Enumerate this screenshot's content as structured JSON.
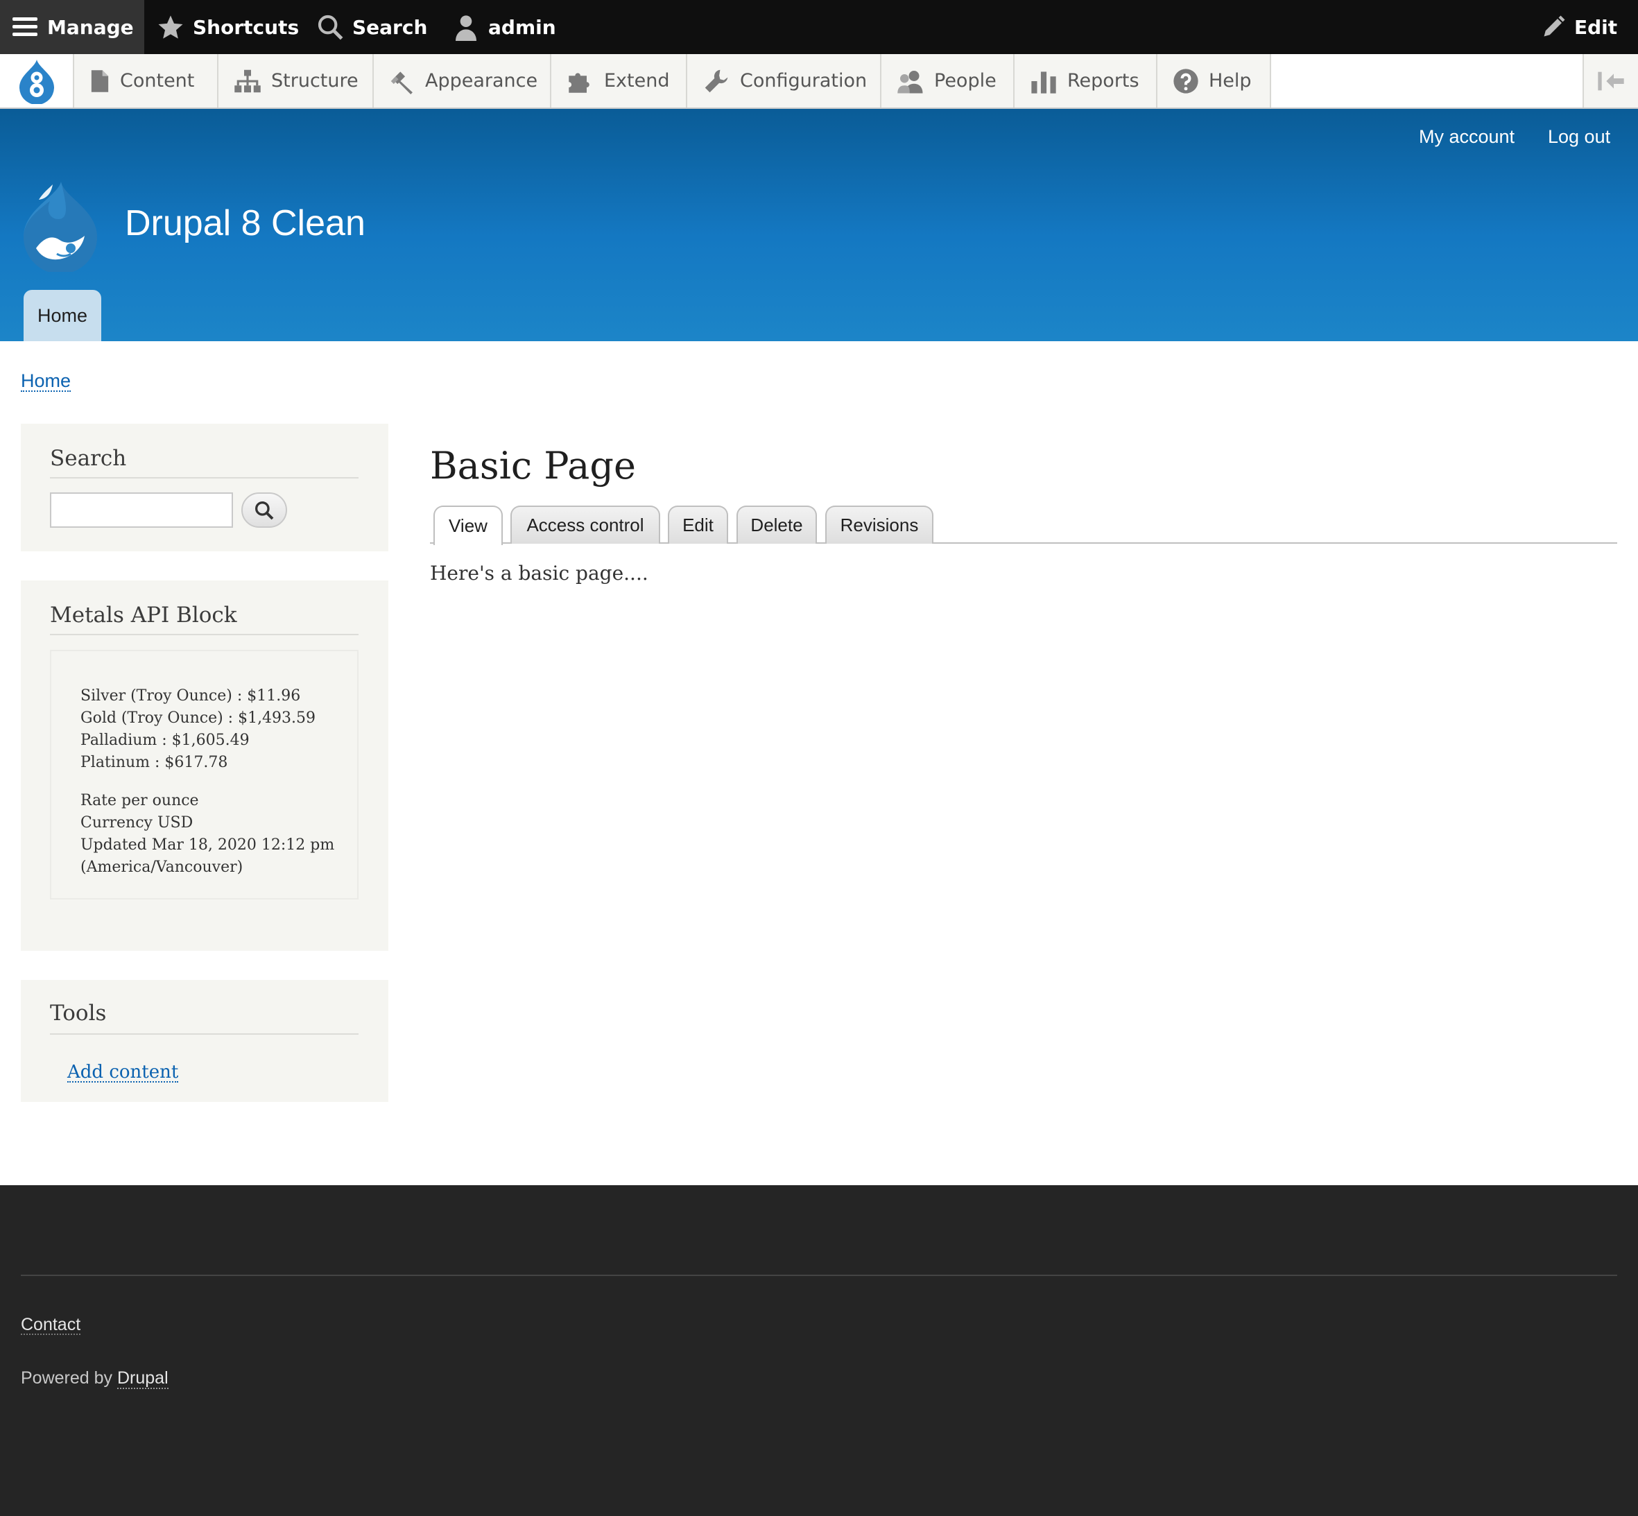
{
  "toolbar": {
    "manage": "Manage",
    "shortcuts": "Shortcuts",
    "search": "Search",
    "user": "admin",
    "edit": "Edit"
  },
  "tray": {
    "items": [
      {
        "label": "Content",
        "icon": "file-icon"
      },
      {
        "label": "Structure",
        "icon": "sitemap-icon"
      },
      {
        "label": "Appearance",
        "icon": "paintbrush-icon"
      },
      {
        "label": "Extend",
        "icon": "puzzle-icon"
      },
      {
        "label": "Configuration",
        "icon": "wrench-icon"
      },
      {
        "label": "People",
        "icon": "people-icon"
      },
      {
        "label": "Reports",
        "icon": "bar-chart-icon"
      },
      {
        "label": "Help",
        "icon": "help-icon"
      }
    ]
  },
  "header": {
    "my_account": "My account",
    "log_out": "Log out",
    "site_name": "Drupal 8 Clean",
    "main_nav_home": "Home"
  },
  "breadcrumb": {
    "home": "Home"
  },
  "sidebar": {
    "search": {
      "title": "Search",
      "placeholder": ""
    },
    "metals": {
      "title": "Metals API Block",
      "rates": [
        "Silver (Troy Ounce) : $11.96",
        "Gold (Troy Ounce) : $1,493.59",
        "Palladium : $1,605.49",
        "Platinum : $617.78"
      ],
      "rate_per": "Rate per ounce",
      "currency": "Currency USD",
      "updated": "Updated Mar 18, 2020 12:12 pm",
      "timezone": "(America/Vancouver)"
    },
    "tools": {
      "title": "Tools",
      "add_content": "Add content"
    }
  },
  "main": {
    "title": "Basic Page",
    "tabs": [
      "View",
      "Access control",
      "Edit",
      "Delete",
      "Revisions"
    ],
    "body": "Here's a basic page...."
  },
  "footer": {
    "contact": "Contact",
    "powered_by": "Powered by",
    "drupal": "Drupal"
  },
  "colors": {
    "toolbar_bg": "#0f0f0f",
    "header_top": "#0a5c97",
    "header_bottom": "#1c85c8",
    "link": "#0b62b0",
    "footer_bg": "#252525"
  }
}
